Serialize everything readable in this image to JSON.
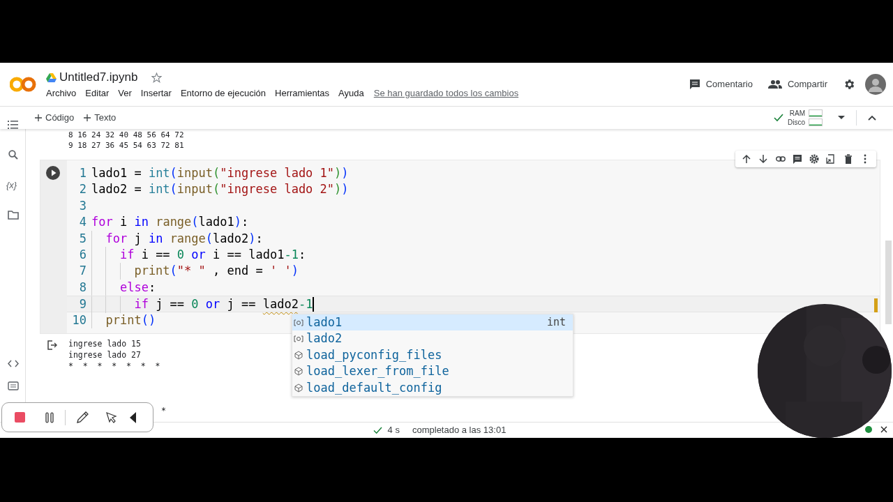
{
  "header": {
    "title": "Untitled7.ipynb",
    "starred": false,
    "menu": [
      "Archivo",
      "Editar",
      "Ver",
      "Insertar",
      "Entorno de ejecución",
      "Herramientas",
      "Ayuda"
    ],
    "save_status": "Se han guardado todos los cambios",
    "actions": [
      {
        "kind": "comment",
        "label": "Comentario"
      },
      {
        "kind": "share",
        "label": "Compartir"
      }
    ]
  },
  "sidebar": {
    "variables_label": "{x}"
  },
  "toolbar": {
    "add_buttons": [
      "Código",
      "Texto"
    ],
    "connected": true,
    "meters": [
      {
        "label": "RAM"
      },
      {
        "label": "Disco"
      }
    ]
  },
  "previous_output": [
    "8 16 24 32 40 48 56 64 72",
    "9 18 27 36 45 54 63 72 81"
  ],
  "cell": {
    "lines": [
      {
        "number": "1",
        "active": false,
        "tokens": [
          {
            "kind": "plain",
            "text": "lado1 = "
          },
          {
            "kind": "builtin",
            "text": "int"
          },
          {
            "kind": "p1",
            "text": "("
          },
          {
            "kind": "func",
            "text": "input"
          },
          {
            "kind": "p2",
            "text": "("
          },
          {
            "kind": "string",
            "text": "\"ingrese lado 1\""
          },
          {
            "kind": "p2",
            "text": ")"
          },
          {
            "kind": "p1",
            "text": ")"
          }
        ]
      },
      {
        "number": "2",
        "active": false,
        "tokens": [
          {
            "kind": "plain",
            "text": "lado2 = "
          },
          {
            "kind": "builtin",
            "text": "int"
          },
          {
            "kind": "p1",
            "text": "("
          },
          {
            "kind": "func",
            "text": "input"
          },
          {
            "kind": "p2",
            "text": "("
          },
          {
            "kind": "string",
            "text": "\"ingrese lado 2\""
          },
          {
            "kind": "p2",
            "text": ")"
          },
          {
            "kind": "p1",
            "text": ")"
          }
        ]
      },
      {
        "number": "3",
        "active": false
      },
      {
        "number": "4",
        "active": false,
        "tokens": [
          {
            "kind": "keyword",
            "text": "for"
          },
          {
            "kind": "plain",
            "text": " i "
          },
          {
            "kind": "operator",
            "text": "in "
          },
          {
            "kind": "func",
            "text": "range"
          },
          {
            "kind": "p1",
            "text": "("
          },
          {
            "kind": "plain",
            "text": "lado1"
          },
          {
            "kind": "p1",
            "text": ")"
          },
          {
            "kind": "plain",
            "text": ":"
          }
        ]
      },
      {
        "number": "5",
        "active": false,
        "tokens": [
          {
            "kind": "keyword",
            "text": "  for"
          },
          {
            "kind": "plain",
            "text": " j "
          },
          {
            "kind": "operator",
            "text": "in "
          },
          {
            "kind": "func",
            "text": "range"
          },
          {
            "kind": "p1",
            "text": "("
          },
          {
            "kind": "plain",
            "text": "lado2"
          },
          {
            "kind": "p1",
            "text": ")"
          },
          {
            "kind": "plain",
            "text": ":"
          }
        ]
      },
      {
        "number": "6",
        "active": false,
        "tokens": [
          {
            "kind": "keyword",
            "text": "    if"
          },
          {
            "kind": "plain",
            "text": " i == "
          },
          {
            "kind": "number",
            "text": "0 "
          },
          {
            "kind": "operator",
            "text": "or"
          },
          {
            "kind": "plain",
            "text": " i == lado1"
          },
          {
            "kind": "number",
            "text": "-1"
          },
          {
            "kind": "plain",
            "text": ":"
          }
        ]
      },
      {
        "number": "7",
        "active": false,
        "tokens": [
          {
            "kind": "func",
            "text": "      print"
          },
          {
            "kind": "p1",
            "text": "("
          },
          {
            "kind": "string",
            "text": "\"* \""
          },
          {
            "kind": "plain",
            "text": " , end = "
          },
          {
            "kind": "string",
            "text": "' '"
          },
          {
            "kind": "p1",
            "text": ")"
          }
        ]
      },
      {
        "number": "8",
        "active": false,
        "tokens": [
          {
            "kind": "keyword",
            "text": "    else"
          },
          {
            "kind": "plain",
            "text": ":"
          }
        ]
      },
      {
        "number": "9",
        "active": true,
        "tokens": [
          {
            "kind": "keyword",
            "text": "      if"
          },
          {
            "kind": "plain",
            "text": " j == "
          },
          {
            "kind": "number",
            "text": "0 "
          },
          {
            "kind": "operator",
            "text": "or"
          },
          {
            "kind": "plain",
            "text": " j == "
          },
          {
            "kind": "plain",
            "text": "lado2",
            "warning": true
          },
          {
            "kind": "number",
            "text": "-1"
          }
        ]
      },
      {
        "number": "10",
        "active": false,
        "tokens": [
          {
            "kind": "func",
            "text": "  print"
          },
          {
            "kind": "p1",
            "text": "("
          },
          {
            "kind": "p1",
            "text": ")"
          }
        ]
      }
    ],
    "output": [
      "ingrese lado 15",
      "ingrese lado 27",
      "*  *  *  *  *  *  *"
    ],
    "output_tail": "*"
  },
  "autocomplete": [
    {
      "kind": "variable",
      "label": "lado1",
      "type": "int",
      "selected": true
    },
    {
      "kind": "variable",
      "label": "lado2",
      "selected": false
    },
    {
      "kind": "module",
      "label": "load_pyconfig_files",
      "selected": false
    },
    {
      "kind": "module",
      "label": "load_lexer_from_file",
      "selected": false
    },
    {
      "kind": "module",
      "label": "load_default_config",
      "selected": false
    }
  ],
  "status": {
    "ok": true,
    "duration": "4 s",
    "message": "completado a las 13:01",
    "connected": true
  }
}
